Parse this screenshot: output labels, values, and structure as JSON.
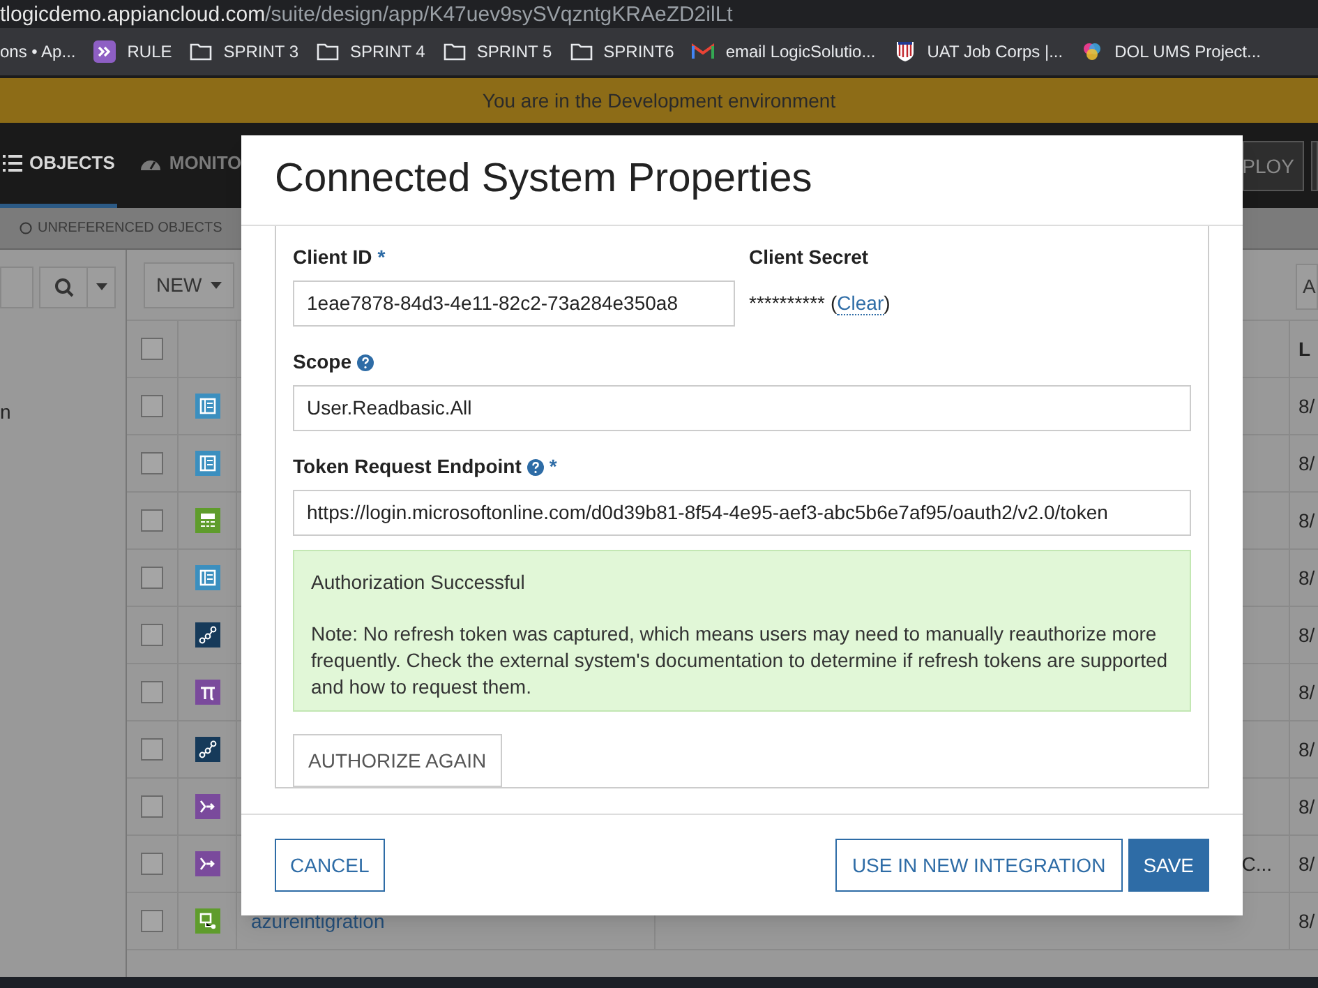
{
  "browser": {
    "url_host": "tlogicdemo.appiancloud.com",
    "url_path": "/suite/design/app/K47uev9sySVqzntgKRAeZD2ilLt",
    "bookmarks": [
      {
        "label": "ons • Ap...",
        "kind": "none"
      },
      {
        "label": "RULE",
        "kind": "app"
      },
      {
        "label": "SPRINT 3",
        "kind": "folder"
      },
      {
        "label": "SPRINT 4",
        "kind": "folder"
      },
      {
        "label": "SPRINT 5",
        "kind": "folder"
      },
      {
        "label": "SPRINT6",
        "kind": "folder"
      },
      {
        "label": "email LogicSolutio...",
        "kind": "mail"
      },
      {
        "label": "UAT Job Corps |...",
        "kind": "shield"
      },
      {
        "label": "DOL UMS Project...",
        "kind": "circles"
      }
    ]
  },
  "banner": "You are in the Development environment",
  "nav": {
    "tabs": [
      {
        "label": "OBJECTS",
        "selected": true
      },
      {
        "label": "MONITO",
        "selected": false
      }
    ],
    "deploy_button": "PLOY"
  },
  "filter": "UNREFERENCED OBJECTS",
  "left_panel": {
    "text": "n"
  },
  "toolbar": {
    "new_button": "NEW",
    "right_button": "A"
  },
  "table": {
    "header_checked": false,
    "last_column_header": "L",
    "rows": [
      {
        "kind": "interface",
        "checked": false,
        "column_4": "8/"
      },
      {
        "kind": "interface",
        "checked": false,
        "column_4": "8/"
      },
      {
        "kind": "record",
        "checked": false,
        "column_4": "8/"
      },
      {
        "kind": "interface",
        "checked": false,
        "column_4": "8/"
      },
      {
        "kind": "process",
        "checked": false,
        "column_4": "8/"
      },
      {
        "kind": "constant",
        "checked": false,
        "column_4": "8/"
      },
      {
        "kind": "process",
        "checked": false,
        "column_4": "8/"
      },
      {
        "kind": "rule",
        "checked": false,
        "column_4": "8/"
      },
      {
        "kind": "rule",
        "checked": false,
        "column_3": "C...",
        "column_4": "8/"
      },
      {
        "kind": "integration",
        "checked": false,
        "name": "azureintigration",
        "column_4": "8/"
      }
    ]
  },
  "dialog": {
    "title": "Connected System Properties",
    "client_id": {
      "label": "Client ID",
      "required_mark": "*",
      "value": "1eae7878-84d3-4e11-82c2-73a284e350a8"
    },
    "client_secret": {
      "label": "Client Secret",
      "masked": "**********",
      "clear_open": "(",
      "clear_link": "Clear",
      "clear_close": ")"
    },
    "scope": {
      "label": "Scope",
      "help": true,
      "value": "User.Readbasic.All"
    },
    "token_endpoint": {
      "label": "Token Request Endpoint",
      "help": true,
      "required_mark": "*",
      "value": "https://login.microsoftonline.com/d0d39b81-8f54-4e95-aef3-abc5b6e7af95/oauth2/v2.0/token"
    },
    "message": {
      "title": "Authorization Successful",
      "note": "Note: No refresh token was captured, which means users may need to manually reauthorize more frequently. Check the external system's documentation to determine if refresh tokens are supported and how to request them."
    },
    "authorize_button": "AUTHORIZE AGAIN",
    "cancel_button": "CANCEL",
    "integration_button": "USE IN NEW INTEGRATION",
    "save_button": "SAVE"
  }
}
